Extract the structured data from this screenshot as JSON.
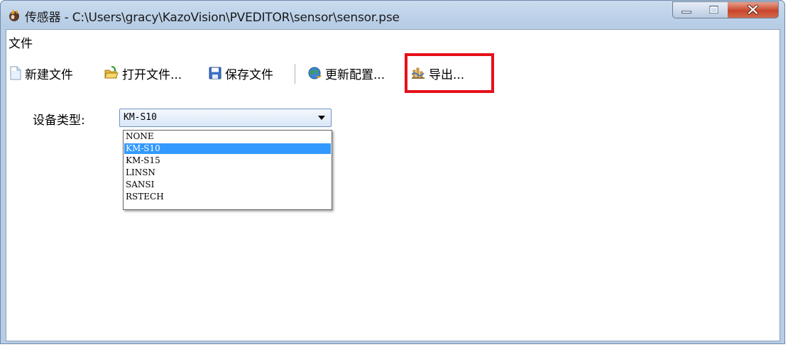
{
  "window": {
    "title": "传感器 - C:\\Users\\gracy\\KazoVision\\PVEDITOR\\sensor\\sensor.pse"
  },
  "menubar": {
    "file": "文件"
  },
  "toolbar": {
    "new_file": "新建文件",
    "open_file": "打开文件...",
    "save_file": "保存文件",
    "update_config": "更新配置...",
    "export": "导出..."
  },
  "form": {
    "device_type_label": "设备类型:",
    "device_type_value": "KM-S10",
    "options": [
      "NONE",
      "KM-S10",
      "KM-S15",
      "LINSN",
      "SANSI",
      "RSTECH"
    ],
    "selected_option": "KM-S10"
  },
  "colors": {
    "highlight_border": "#e5101a",
    "selection": "#3399ff",
    "close_button": "#c8452c"
  }
}
